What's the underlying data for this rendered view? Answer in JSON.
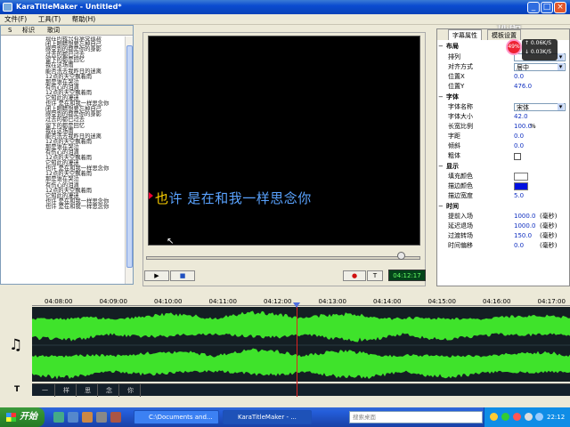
{
  "window": {
    "title": "KaraTitleMaker - Untitled*",
    "minimize": "_",
    "maximize": "□",
    "close": "×"
  },
  "watermark": "优酷",
  "menu": [
    {
      "label": "文件(F)"
    },
    {
      "label": "工具(T)"
    },
    {
      "label": "帮助(H)"
    }
  ],
  "list": {
    "col_s": "S",
    "col_mark": "标识",
    "col_lyrics": "歌词",
    "lines": [
      "现在的我只有承受孤寂",
      "闭上眼睛想要忘掉自己",
      "感受到的都是你的身影",
      "过去的都已过去",
      "留下的都是回忆",
      "我在这场雨",
      "能否洗去我昨日的迷离",
      "12点的天空飘着雨",
      "那是谁在哭泣",
      "有伤心的泪滴",
      "12点的天空飘着雨",
      "它知此的凄迷",
      "也许 是在和我一样思念你",
      "闭上眼睛想要忘掉自己",
      "感受到的都是你的身影",
      "过去的都已过去",
      "留下的都是回忆",
      "我在这场雨",
      "能否洗去我昨日的迷离",
      "12点的天空飘着雨",
      "那是谁在哭泣",
      "有伤心的泪滴",
      "12点的天空飘着雨",
      "它知此的凄迷",
      "也许 是在和我一样思念你",
      "12点的天空飘着雨",
      "那是谁在哭泣",
      "有伤心的泪滴",
      "12点的天空飘着雨",
      "它知此的凄迷",
      "也许 是在和我一样思念你",
      "也许 是在和我一样思念你"
    ]
  },
  "preview": {
    "highlight": "也",
    "rest": "许 是在和我一样思念你"
  },
  "playback": {
    "play": "▶",
    "stop": "■",
    "record": "●",
    "text": "T",
    "time": "04:12:17",
    "seek_fraction": 0.93
  },
  "props": {
    "tab_active": "字幕属性",
    "tab_other": "模板设置",
    "sections": {
      "layout": "布局",
      "font": "字体",
      "display": "显示",
      "time": "时间"
    },
    "rows": {
      "arrange": {
        "label": "排列",
        "value": ""
      },
      "align": {
        "label": "对齐方式",
        "value": "居中"
      },
      "pos_x": {
        "label": "位置X",
        "value": "0.0"
      },
      "pos_y": {
        "label": "位置Y",
        "value": "476.0"
      },
      "font_name": {
        "label": "字体名称",
        "value": "宋体"
      },
      "font_size": {
        "label": "字体大小",
        "value": "42.0"
      },
      "ratio": {
        "label": "长宽比例",
        "value": "100.0",
        "unit": "%"
      },
      "spacing": {
        "label": "字距",
        "value": "0.0"
      },
      "tilt": {
        "label": "倾斜",
        "value": "0.0"
      },
      "bold": {
        "label": "粗体"
      },
      "fill_color": {
        "label": "填充颜色",
        "value": "#ffffff"
      },
      "stroke_color": {
        "label": "描边颜色",
        "value": "#0010e0"
      },
      "stroke_width": {
        "label": "描边宽度",
        "value": "5.0"
      },
      "enter_early": {
        "label": "提前入场",
        "value": "1000.0",
        "unit": "(毫秒)"
      },
      "exit_late": {
        "label": "延迟退场",
        "value": "1000.0",
        "unit": "(毫秒)"
      },
      "transition": {
        "label": "过渡转场",
        "value": "150.0",
        "unit": "(毫秒)"
      },
      "offset": {
        "label": "时间偏移",
        "value": "0.0",
        "unit": "(毫秒)"
      }
    }
  },
  "net": {
    "badge": "49%",
    "up": "↑ 0.06K/S",
    "down": "↓ 0.03K/S"
  },
  "timeline": {
    "ticks": [
      "04:08:00",
      "04:09:00",
      "04:10:00",
      "04:11:00",
      "04:12:00",
      "04:13:00",
      "04:14:00",
      "04:15:00",
      "04:16:00",
      "04:17:00"
    ],
    "chars": [
      "一",
      "样",
      "思",
      "念",
      "你"
    ],
    "note_icon": "♫",
    "text_icon": "T"
  },
  "taskbar": {
    "start": "开始",
    "tasks": [
      {
        "label": "C:\\Documents and..."
      },
      {
        "label": "KaraTitleMaker - ..."
      }
    ],
    "search_placeholder": "搜索桌面",
    "clock": "22:12"
  }
}
